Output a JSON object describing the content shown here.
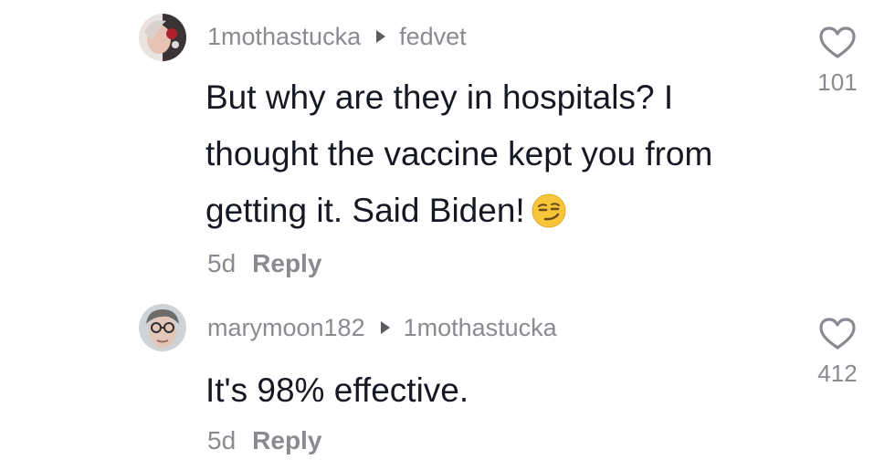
{
  "comments": [
    {
      "username": "1mothastucka",
      "reply_to": "fedvet",
      "text": "But why are they in hospitals? I thought the vaccine kept you from getting it. Said Biden!",
      "emoji": "smirk-emoji",
      "time": "5d",
      "reply_label": "Reply",
      "likes": "101"
    },
    {
      "username": "marymoon182",
      "reply_to": "1mothastucka",
      "text": "It's 98% effective.",
      "time": "5d",
      "reply_label": "Reply",
      "likes": "412"
    }
  ],
  "colors": {
    "text": "#161823",
    "muted": "#8a8b91",
    "background": "#ffffff"
  }
}
